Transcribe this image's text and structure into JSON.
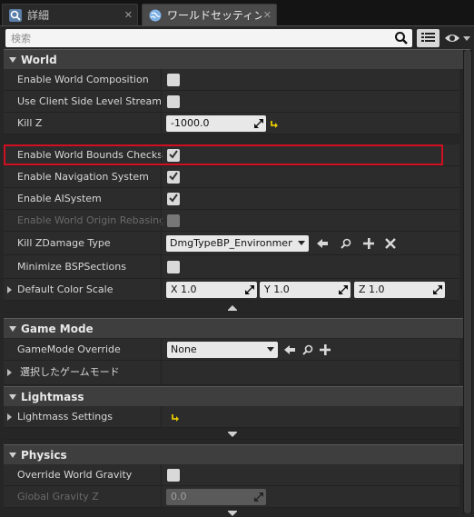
{
  "tabs": [
    {
      "label": "詳細",
      "close": "✕",
      "icon": "details-magnifier-icon"
    },
    {
      "label": "ワールドセッティング",
      "close": "✕",
      "icon": "world-globe-icon"
    }
  ],
  "search": {
    "placeholder": "検索",
    "value": ""
  },
  "categories": {
    "world": "World",
    "game_mode": "Game Mode",
    "lightmass": "Lightmass",
    "physics": "Physics"
  },
  "world": {
    "enable_world_composition": {
      "label": "Enable World Composition",
      "checked": false
    },
    "use_client_side_level_streaming": {
      "label": "Use Client Side Level Streaming",
      "checked": false
    },
    "kill_z": {
      "label": "Kill Z",
      "value": "-1000.0"
    },
    "enable_world_bounds_checks": {
      "label": "Enable World Bounds Checks",
      "checked": true
    },
    "enable_navigation_system": {
      "label": "Enable Navigation System",
      "checked": true
    },
    "enable_ai_system": {
      "label": "Enable AISystem",
      "checked": true
    },
    "enable_world_origin_rebasing": {
      "label": "Enable World Origin Rebasing",
      "checked": false,
      "disabled": true
    },
    "kill_z_damage_type": {
      "label": "Kill ZDamage Type",
      "value": "DmgTypeBP_Environmental"
    },
    "minimize_bsp_sections": {
      "label": "Minimize BSPSections",
      "checked": false
    },
    "default_color_scale": {
      "label": "Default Color Scale",
      "x": "X  1.0",
      "y": "Y  1.0",
      "z": "Z  1.0"
    }
  },
  "game_mode": {
    "override": {
      "label": "GameMode Override",
      "value": "None"
    },
    "selected": {
      "label": "選択したゲームモード"
    }
  },
  "lightmass": {
    "settings": {
      "label": "Lightmass Settings"
    }
  },
  "physics": {
    "override_world_gravity": {
      "label": "Override World Gravity",
      "checked": false
    },
    "global_gravity_z": {
      "label": "Global Gravity Z",
      "value": "0.0",
      "disabled": true
    }
  },
  "colors": {
    "highlight": "#d01020",
    "reset_arrow": "#e6c800"
  }
}
